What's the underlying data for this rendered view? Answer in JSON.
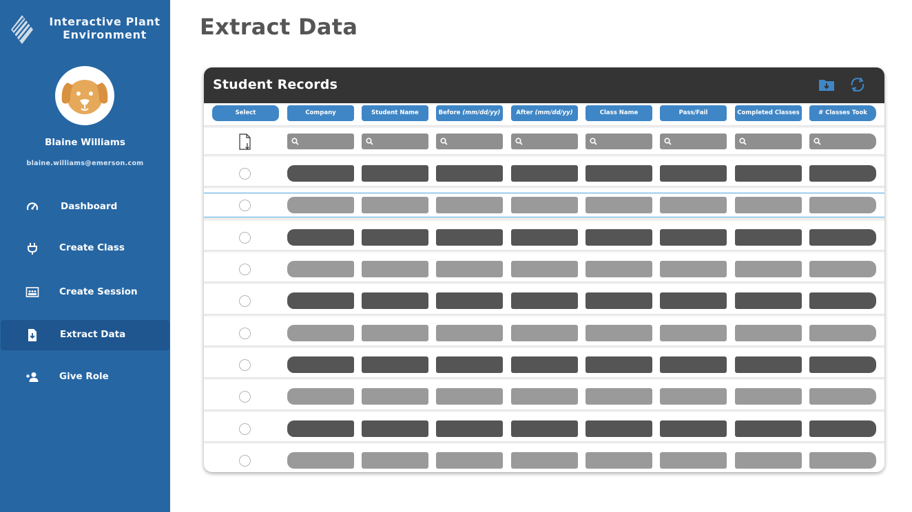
{
  "sidebar": {
    "brand": {
      "line1": "Interactive Plant",
      "line2": "Environment"
    },
    "user": {
      "name": "Blaine Williams",
      "email": "blaine.williams@emerson.com"
    },
    "nav": [
      {
        "label": "Dashboard",
        "icon": "speedometer-icon"
      },
      {
        "label": "Create Class",
        "icon": "plug-icon"
      },
      {
        "label": "Create Session",
        "icon": "presentation-icon"
      },
      {
        "label": "Extract Data",
        "icon": "file-download-icon",
        "active": true
      },
      {
        "label": "Give Role",
        "icon": "add-user-icon"
      }
    ]
  },
  "page": {
    "title": "Extract Data"
  },
  "records": {
    "title": "Student Records",
    "actions": [
      "folder-download-icon",
      "refresh-icon"
    ],
    "columns": {
      "select": "Select",
      "company": "Company",
      "student_name": "Student Name",
      "before": "Before",
      "before_fmt": "(mm/dd/yy)",
      "after": "After",
      "after_fmt": "(mm/dd/yy)",
      "class_name": "Class Name",
      "pass_fail": "Pass/Fail",
      "completed_classes": "Completed Classes",
      "classes_took": "# Classes Took"
    },
    "row_count": 10,
    "selected_row": 2
  },
  "colors": {
    "sidebar": "#2666a3",
    "sidebar_active": "#1f5690",
    "header_bar": "#343434",
    "column_header": "#3f86c6",
    "row_dark": "#555555",
    "row_light": "#9a9a9a",
    "search_field": "#8f8f8f",
    "selection_outline": "#4aa3d9"
  }
}
